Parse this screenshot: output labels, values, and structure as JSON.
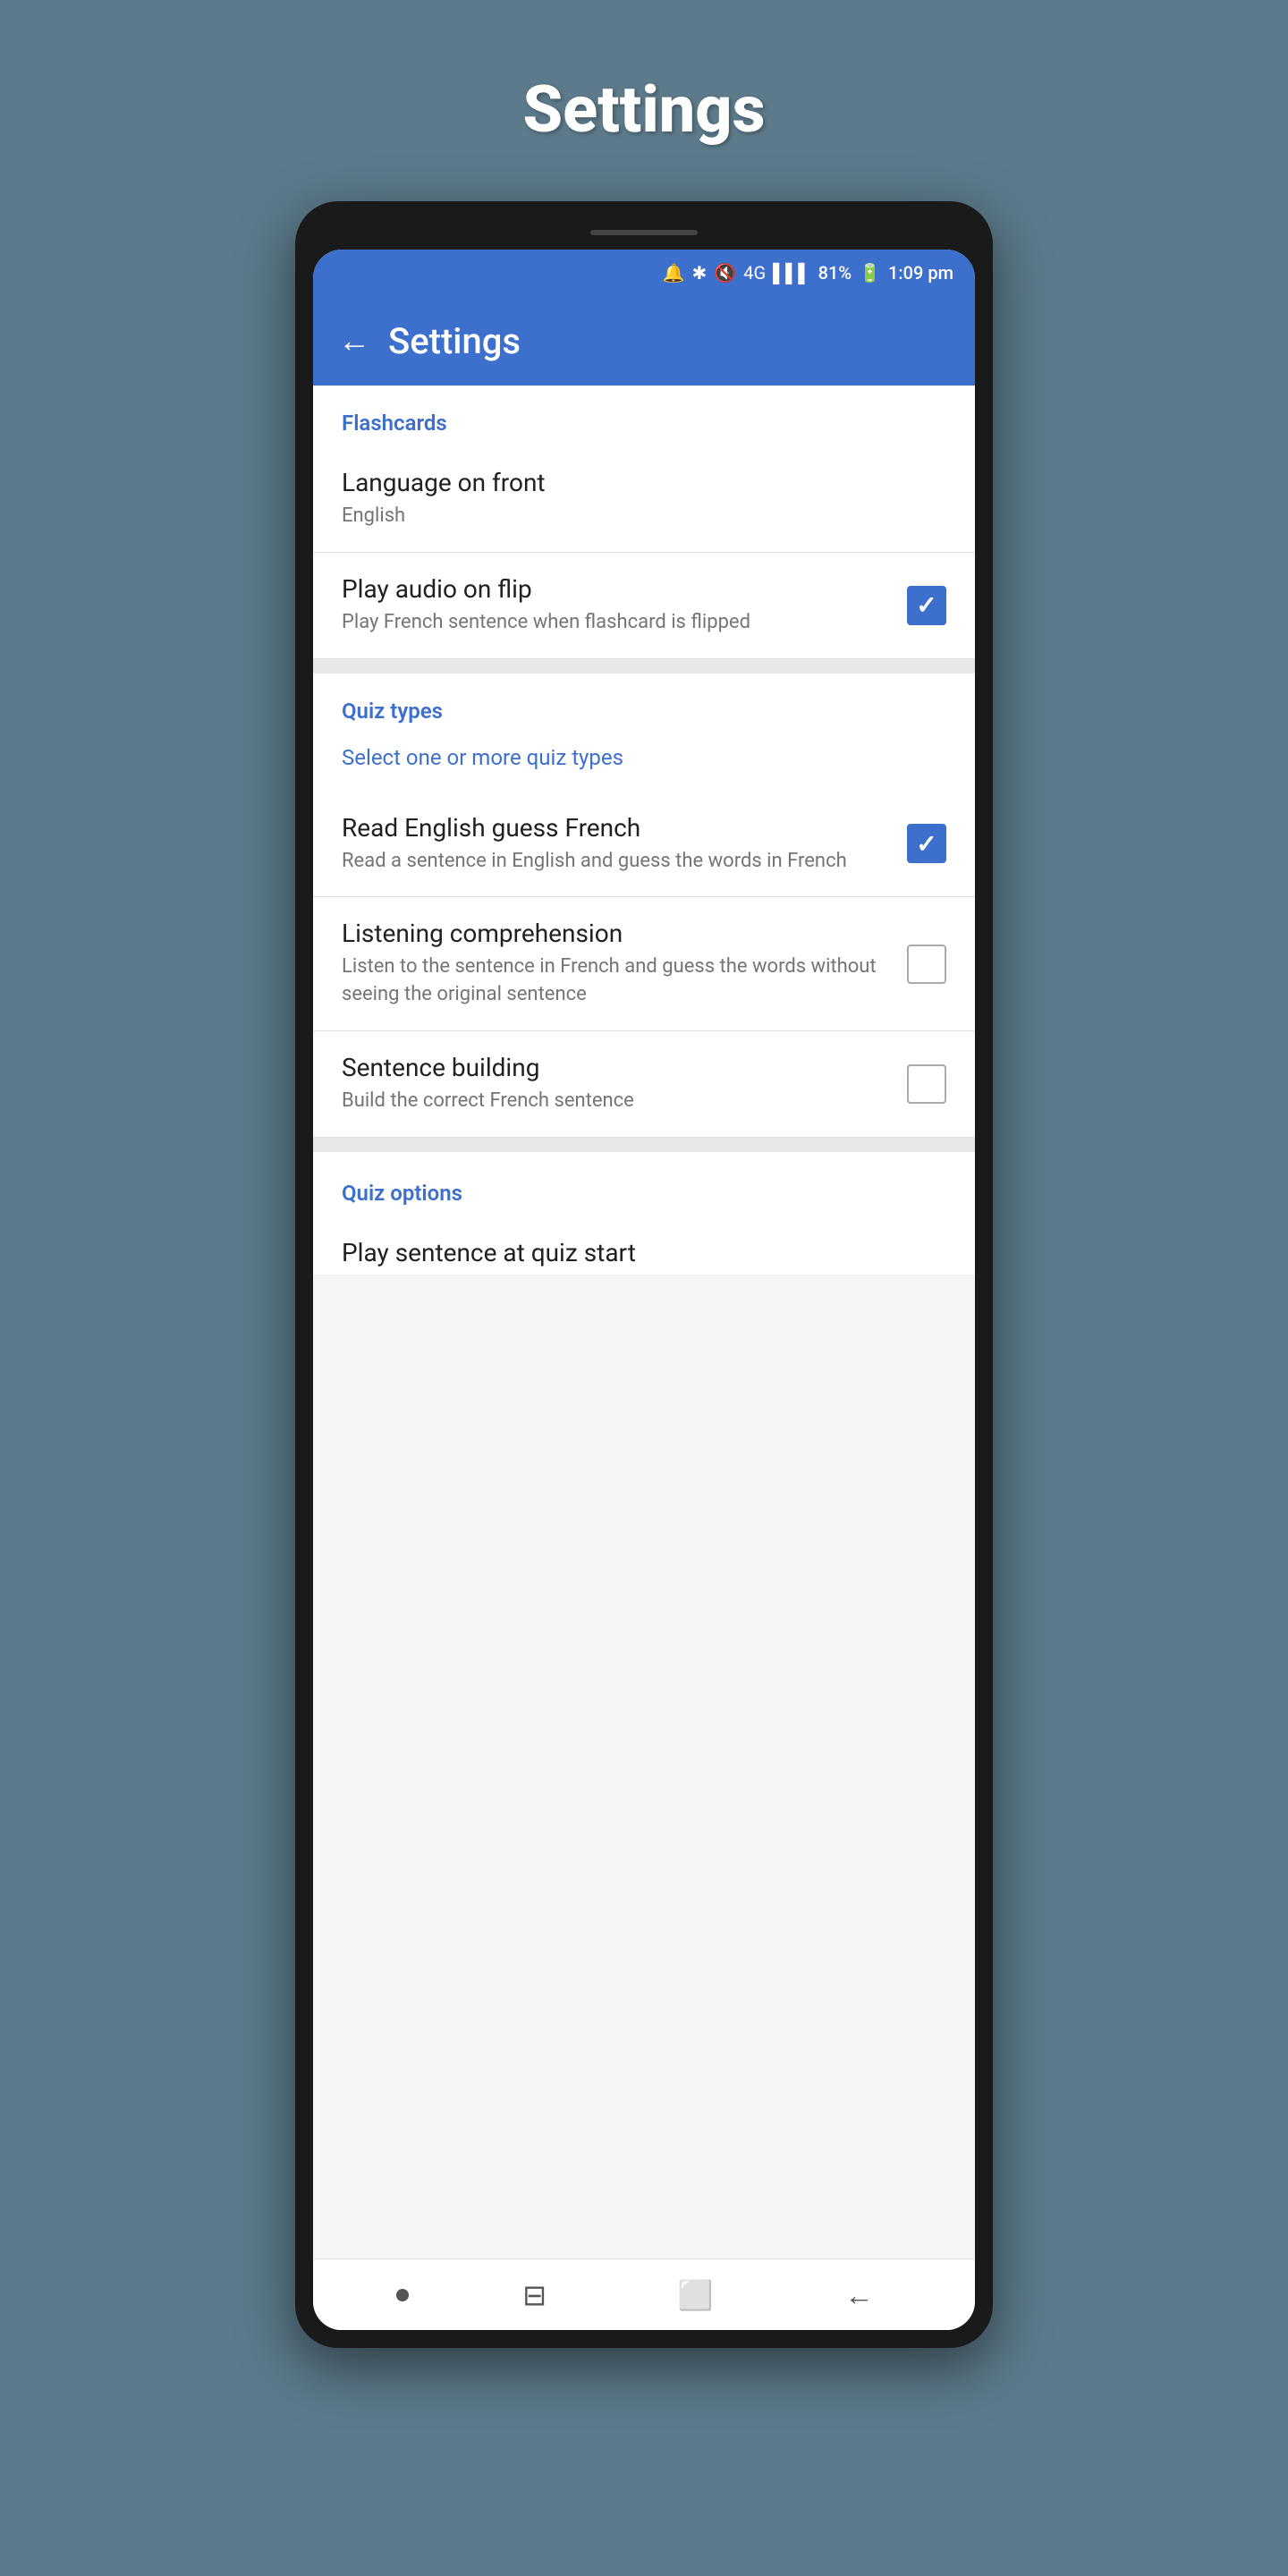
{
  "page": {
    "title": "Settings"
  },
  "statusBar": {
    "time": "1:09 pm",
    "battery": "81%"
  },
  "appBar": {
    "title": "Settings",
    "backLabel": "←"
  },
  "sections": {
    "flashcards": {
      "label": "Flashcards",
      "items": [
        {
          "id": "language-front",
          "title": "Language on front",
          "subtitle": "English",
          "hasCheckbox": false
        },
        {
          "id": "play-audio",
          "title": "Play audio on flip",
          "subtitle": "Play French sentence when flashcard is flipped",
          "hasCheckbox": true,
          "checked": true
        }
      ]
    },
    "quizTypes": {
      "label": "Quiz types",
      "hint": "Select one or more quiz types",
      "items": [
        {
          "id": "read-english-guess-french",
          "title": "Read English guess French",
          "subtitle": "Read a sentence in English and guess the words in French",
          "hasCheckbox": true,
          "checked": true
        },
        {
          "id": "listening-comprehension",
          "title": "Listening comprehension",
          "subtitle": "Listen to the sentence in French and guess the words without seeing the original sentence",
          "hasCheckbox": true,
          "checked": false
        },
        {
          "id": "sentence-building",
          "title": "Sentence building",
          "subtitle": "Build the correct French sentence",
          "hasCheckbox": true,
          "checked": false
        }
      ]
    },
    "quizOptions": {
      "label": "Quiz options",
      "partialItem": "Play sentence at quiz start"
    }
  },
  "bottomNav": {
    "home": "●",
    "recent": "⊟",
    "overview": "⬜",
    "back": "←"
  }
}
